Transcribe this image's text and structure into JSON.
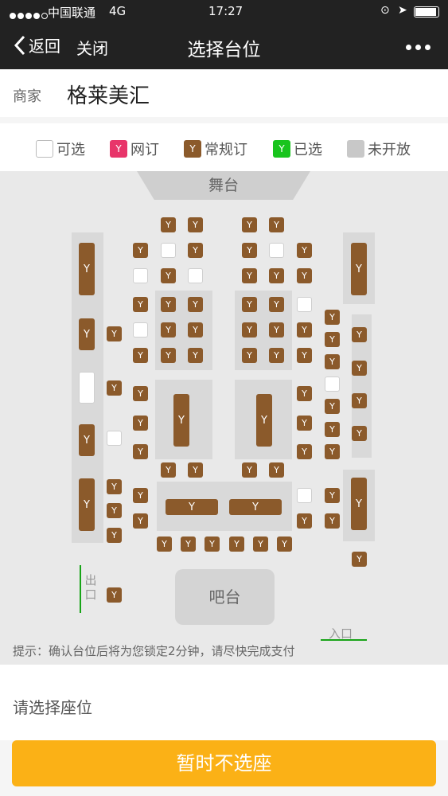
{
  "status": {
    "carrier": "中国联通",
    "network": "4G",
    "time": "17:27"
  },
  "nav": {
    "back": "返回",
    "close": "关闭",
    "title": "选择台位"
  },
  "merchant": {
    "label": "商家",
    "name": "格莱美汇"
  },
  "legend": {
    "available": "可选",
    "online": "网订",
    "regular": "常规订",
    "selected": "已选",
    "closed": "未开放"
  },
  "colors": {
    "online": "#e8356a",
    "regular": "#8b5a2b",
    "selected": "#18c41d",
    "closed": "#c8c8c8",
    "button": "#fbb116"
  },
  "map": {
    "stage": "舞台",
    "bar": "吧台",
    "exit": "出口",
    "entry": "入口",
    "seat_icon": "cocktail-glass-icon",
    "hint": "提示：确认台位后将为您锁定2分钟，请尽快完成支付"
  },
  "choose_prompt": "请选择座位",
  "skip_button": "暂时不选座"
}
